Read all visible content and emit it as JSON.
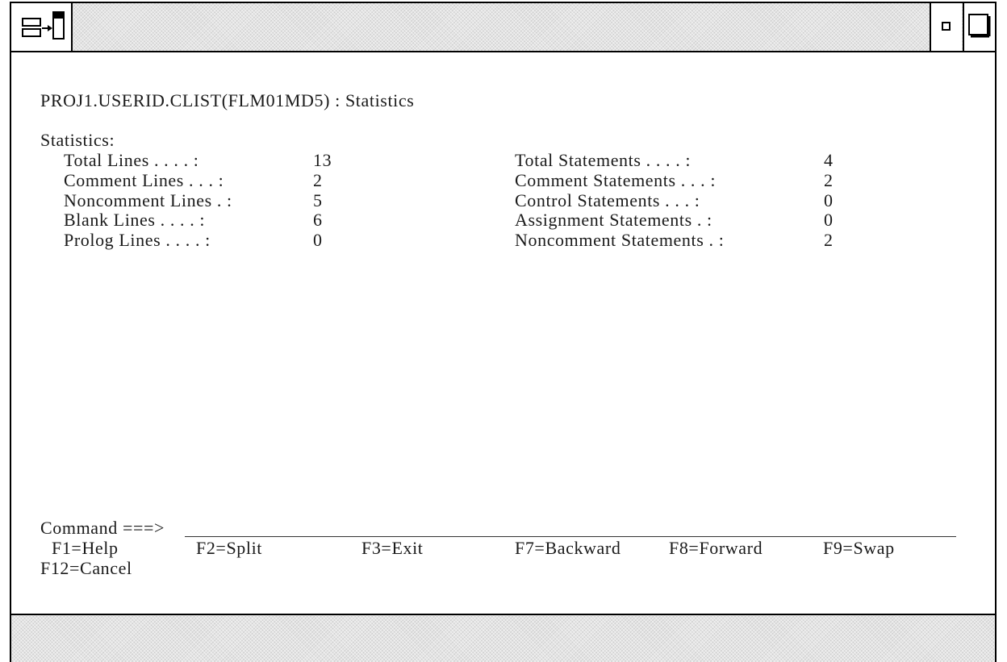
{
  "panel": {
    "title": "PROJ1.USERID.CLIST(FLM01MD5) : Statistics",
    "section_heading": "Statistics:"
  },
  "stats_left": [
    {
      "label": "Total Lines . . . . :",
      "value": "13"
    },
    {
      "label": "Comment Lines . . . :",
      "value": "2"
    },
    {
      "label": "Noncomment Lines . :",
      "value": "5"
    },
    {
      "label": "Blank Lines . . . . :",
      "value": "6"
    },
    {
      "label": "Prolog Lines . . . . :",
      "value": "0"
    }
  ],
  "stats_right": [
    {
      "label": "Total Statements . . . . :",
      "value": "4"
    },
    {
      "label": "Comment Statements . . . :",
      "value": "2"
    },
    {
      "label": "Control Statements . . . :",
      "value": "0"
    },
    {
      "label": "Assignment Statements . :",
      "value": "0"
    },
    {
      "label": "Noncomment Statements . :",
      "value": "2"
    }
  ],
  "command": {
    "label": "Command ===>",
    "value": ""
  },
  "function_keys": {
    "f1": "F1=Help",
    "f2": "F2=Split",
    "f3": "F3=Exit",
    "f7": "F7=Backward",
    "f8": "F8=Forward",
    "f9": "F9=Swap",
    "f12": "F12=Cancel"
  },
  "icons": {
    "system_menu": "system-menu-icon",
    "minimize": "minimize-icon",
    "maximize": "maximize-icon"
  }
}
